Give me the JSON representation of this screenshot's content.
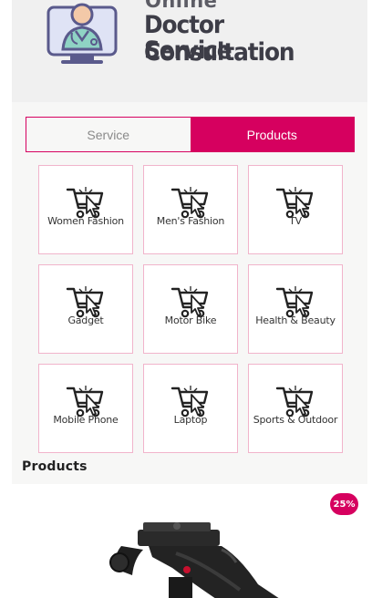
{
  "banner": {
    "line1": "Online",
    "line2": "Doctor Consultation",
    "line3": "Service",
    "icon": "doctor-monitor-icon"
  },
  "tabs": [
    {
      "label": "Service",
      "active": false
    },
    {
      "label": "Products",
      "active": true
    }
  ],
  "categories": [
    {
      "label": "Women Fashion",
      "icon": "cart-icon"
    },
    {
      "label": "Men's Fashion",
      "icon": "cart-icon"
    },
    {
      "label": "TV",
      "icon": "cart-icon"
    },
    {
      "label": "Gadget",
      "icon": "cart-icon"
    },
    {
      "label": "Motor Bike",
      "icon": "cart-icon"
    },
    {
      "label": "Health & Beauty",
      "icon": "cart-icon"
    },
    {
      "label": "Mobile Phone",
      "icon": "cart-icon"
    },
    {
      "label": "Laptop",
      "icon": "cart-icon"
    },
    {
      "label": "Sports & Outdoor",
      "icon": "cart-icon"
    }
  ],
  "products_section": {
    "title": "Products",
    "items": [
      {
        "discount": "25%",
        "image": "tripod-head-image"
      }
    ]
  },
  "colors": {
    "accent": "#d6005f",
    "category_border": "#f1b4cb"
  }
}
